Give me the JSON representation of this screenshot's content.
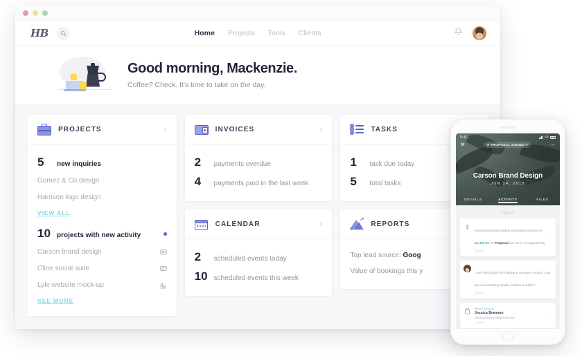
{
  "window": {
    "traffic_lights": [
      "red",
      "yellow",
      "green"
    ]
  },
  "nav": {
    "brand": "HB",
    "search_icon": "search-icon",
    "links": [
      {
        "label": "Home",
        "active": true
      },
      {
        "label": "Projects",
        "active": false
      },
      {
        "label": "Tools",
        "active": false
      },
      {
        "label": "Clients",
        "active": false
      }
    ],
    "bell_icon": "bell-icon",
    "avatar_name": "user-avatar"
  },
  "hero": {
    "greeting": "Good morning, Mackenzie.",
    "subtitle": "Coffee? Check. It's time to take on the day.",
    "illustration": "coffee-moka-pot-illustration"
  },
  "cards": {
    "projects": {
      "title": "PROJECTS",
      "icon": "briefcase-icon",
      "chevron": "›",
      "stat_1": {
        "number": "5",
        "label": "new inquiries"
      },
      "inquiries": [
        {
          "name": "Gomez & Co design"
        },
        {
          "name": "Harrison logo design"
        }
      ],
      "view_all": "VIEW ALL",
      "stat_2": {
        "number": "10",
        "label": "projects with new activity"
      },
      "activity": [
        {
          "name": "Carson brand design",
          "icon": "comment-icon"
        },
        {
          "name": "Cline social suite",
          "icon": "comment-icon"
        },
        {
          "name": "Lyle website mock-up",
          "icon": "signature-icon"
        }
      ],
      "see_more": "SEE MORE"
    },
    "invoices": {
      "title": "INVOICES",
      "icon": "wallet-icon",
      "chevron": "›",
      "stats": [
        {
          "number": "2",
          "label": "payments overdue"
        },
        {
          "number": "4",
          "label": "payments paid in the last week"
        }
      ]
    },
    "calendar": {
      "title": "CALENDAR",
      "icon": "calendar-icon",
      "chevron": "›",
      "stats": [
        {
          "number": "2",
          "label": "scheduled events today"
        },
        {
          "number": "10",
          "label": "scheduled events this week"
        }
      ]
    },
    "tasks": {
      "title": "TASKS",
      "icon": "task-list-icon",
      "chevron": "›",
      "stats": [
        {
          "number": "1",
          "label": "task due today"
        },
        {
          "number": "5",
          "label": "total tasks"
        }
      ]
    },
    "reports": {
      "title": "REPORTS",
      "icon": "chart-icon",
      "chevron": "›",
      "line_1_label": "Top lead source:",
      "line_1_value": "Goog",
      "line_2": "Value of bookings this y"
    }
  },
  "phone": {
    "status": {
      "time": "9:41",
      "signal_icon": "signal-icon",
      "wifi_icon": "wifi-icon",
      "battery_icon": "battery-icon"
    },
    "close_icon": "close-icon",
    "more_icon": "more-options-icon",
    "badge": "PROPOSAL SIGNED",
    "badge_caret": "▾",
    "project_title": "Carson Brand Design",
    "project_date": "JUN 24, 2018",
    "tabs": [
      {
        "label": "DETAILS",
        "active": false
      },
      {
        "label": "ACTIVITY",
        "active": true
      },
      {
        "label": "FILES",
        "active": false
      }
    ],
    "today_label": "TODAY",
    "feed": [
      {
        "type": "payment",
        "icon": "dollar-icon",
        "text_1": "Jessica Brannon booked and paid a retainer of ",
        "amount": "$2,480.00",
        "text_2": " on ",
        "bold": "Proposal",
        "text_3": " via CC (1 of 2 payments)",
        "time": "4:54 PM",
        "arrow": "›"
      },
      {
        "type": "chat",
        "icon": "contact-avatar",
        "message": "I love the proofs from Becky & George's project. Can we do something similar in black & white?",
        "time": "3:26 PM"
      },
      {
        "type": "inquiry",
        "icon": "new-inquiry-icon",
        "label": "New inquiry!",
        "name": "Jessica Brannon",
        "email": "jessica.brannon@gmail.com",
        "time": "2:16 PM",
        "arrow": "›"
      }
    ]
  },
  "colors": {
    "accent_blue": "#5a64c8",
    "link_teal": "#8ed4e0",
    "money_green": "#3fbf8f",
    "dot_blue": "#4a6bd8"
  }
}
